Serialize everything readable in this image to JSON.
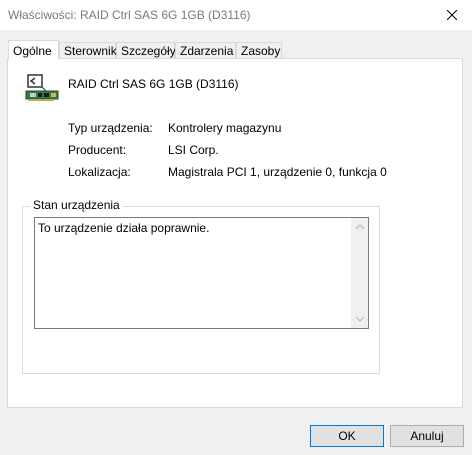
{
  "window": {
    "title": "Właściwości: RAID Ctrl SAS 6G 1GB (D3116)",
    "close_icon": "close-icon"
  },
  "tabs": [
    {
      "label": "Ogólne",
      "active": true
    },
    {
      "label": "Sterownik",
      "active": false
    },
    {
      "label": "Szczegóły",
      "active": false
    },
    {
      "label": "Zdarzenia",
      "active": false
    },
    {
      "label": "Zasoby",
      "active": false
    }
  ],
  "device": {
    "icon": "raid-controller-icon",
    "name": "RAID Ctrl SAS 6G 1GB (D3116)"
  },
  "properties": [
    {
      "label": "Typ urządzenia:",
      "value": "Kontrolery magazynu"
    },
    {
      "label": "Producent:",
      "value": "LSI Corp."
    },
    {
      "label": "Lokalizacja:",
      "value": "Magistrala PCI 1, urządzenie 0, funkcja 0"
    }
  ],
  "status": {
    "group_label": "Stan urządzenia",
    "text": "To urządzenie działa poprawnie."
  },
  "buttons": {
    "ok": "OK",
    "cancel": "Anuluj"
  }
}
